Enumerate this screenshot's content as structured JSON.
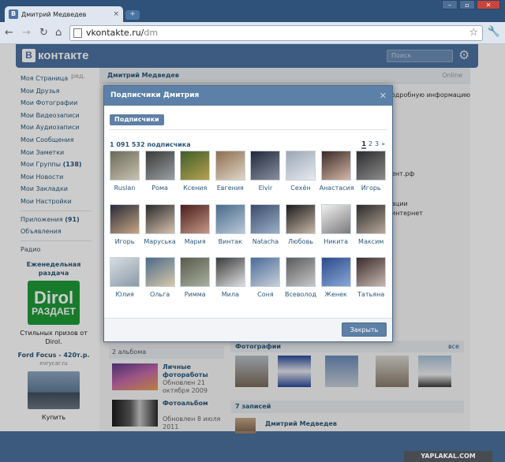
{
  "browser": {
    "tab_title": "Дмитрий Медведев",
    "tab_icon": "В",
    "new_tab": "+",
    "url_host": "vkontakte.ru/",
    "url_path": "dm",
    "nav": {
      "back": "←",
      "forward": "→",
      "reload": "↻",
      "home": "⌂"
    },
    "window_controls": [
      "–",
      "▫",
      "✕"
    ]
  },
  "vk": {
    "logo_letter": "В",
    "logo_text": "контакте",
    "search_placeholder": "Поиск",
    "settings_glyph": "⚙"
  },
  "left_nav": {
    "edit": "ред.",
    "items": [
      "Моя Страница",
      "Мои Друзья",
      "Мои Фотографии",
      "Мои Видеозаписи",
      "Мои Аудиозаписи",
      "Мои Сообщения",
      "Мои Заметки",
      "Мои Группы",
      "Мои Новости",
      "Мои Закладки",
      "Мои Настройки"
    ],
    "groups_count": "(138)",
    "apps": "Приложения",
    "apps_count": "(91)",
    "ads": "Объявления",
    "radio": "Радио"
  },
  "ad1": {
    "title": "Еженедельная раздача",
    "brand": "Dirol",
    "brand_sub": "РАЗДАЕТ",
    "text": "Стильных призов от Dirol."
  },
  "ad2": {
    "title": "Ford Focus - 420т.р.",
    "domain": "evrycar.ru",
    "action": "Купить"
  },
  "profile": {
    "name": "Дмитрий Медведев",
    "status": "Online",
    "frag_info": "одробную информацию",
    "frag_site": "ент.рф",
    "frag_a": "ации",
    "frag_b": "интернет"
  },
  "albums": {
    "header": "2 альбома",
    "items": [
      {
        "title": "Личные фотоработы",
        "sub": "Обновлен 21 октября 2009"
      },
      {
        "title": "Фотоальбом",
        "sub": "Обновлен 8 июля 2011"
      }
    ]
  },
  "photos": {
    "title": "Фотографии",
    "all": "все"
  },
  "posts": {
    "header": "7 записей",
    "author": "Дмитрий Медведев"
  },
  "modal": {
    "title": "Подписчики Дмитрия",
    "close": "✕",
    "tab": "Подписчики",
    "count": "1 091 532 подписчика",
    "pages": [
      "1",
      "2",
      "3",
      "»"
    ],
    "button": "Закрыть",
    "followers": [
      "Ruslan",
      "Рома",
      "Ксения",
      "Евгения",
      "Elvir",
      "Сехён",
      "Анастасия",
      "Игорь",
      "Игорь",
      "Маруська",
      "Мария",
      "Винтак",
      "Natacha",
      "Любовь",
      "Никита",
      "Максим",
      "Юлия",
      "Ольга",
      "Римма",
      "Мила",
      "Соня",
      "Всеволод",
      "Женек",
      "Татьяна"
    ],
    "photo_colors": [
      [
        "#6a6a5a",
        "#c9c2b0"
      ],
      [
        "#3a3a3a",
        "#9aa0a0"
      ],
      [
        "#3f5d2a",
        "#b7a14f"
      ],
      [
        "#8d6e4e",
        "#e0d6c8"
      ],
      [
        "#1f2a3a",
        "#8a8fa0"
      ],
      [
        "#9aa6b4",
        "#e7eaf0"
      ],
      [
        "#3a2a26",
        "#d6b8a8"
      ],
      [
        "#2c2c2c",
        "#8c8c8c"
      ],
      [
        "#2a2a3a",
        "#c6a682"
      ],
      [
        "#2a2a2a",
        "#d6c2b0"
      ],
      [
        "#4a1e1a",
        "#c49888"
      ],
      [
        "#4a6a8a",
        "#b8c8d8"
      ],
      [
        "#3a4a6a",
        "#9ab0c8"
      ],
      [
        "#1a1a1a",
        "#c8b8a8"
      ],
      [
        "#f0f0f0",
        "#7a7a7a"
      ],
      [
        "#2a2a2a",
        "#b8a898"
      ],
      [
        "#d8dde2",
        "#8a9aa8"
      ],
      [
        "#4a6a8a",
        "#d8c8a8"
      ],
      [
        "#5a5a4a",
        "#a8b0a0"
      ],
      [
        "#3a3a3a",
        "#e0e0e0"
      ],
      [
        "#4a6a9a",
        "#c8d0d8"
      ],
      [
        "#5a5a5a",
        "#c8c8c8"
      ],
      [
        "#2a4a8a",
        "#8aa8d8"
      ],
      [
        "#3a2a2a",
        "#c8b8b0"
      ]
    ]
  },
  "watermark": "YAPLAKAL.COM"
}
